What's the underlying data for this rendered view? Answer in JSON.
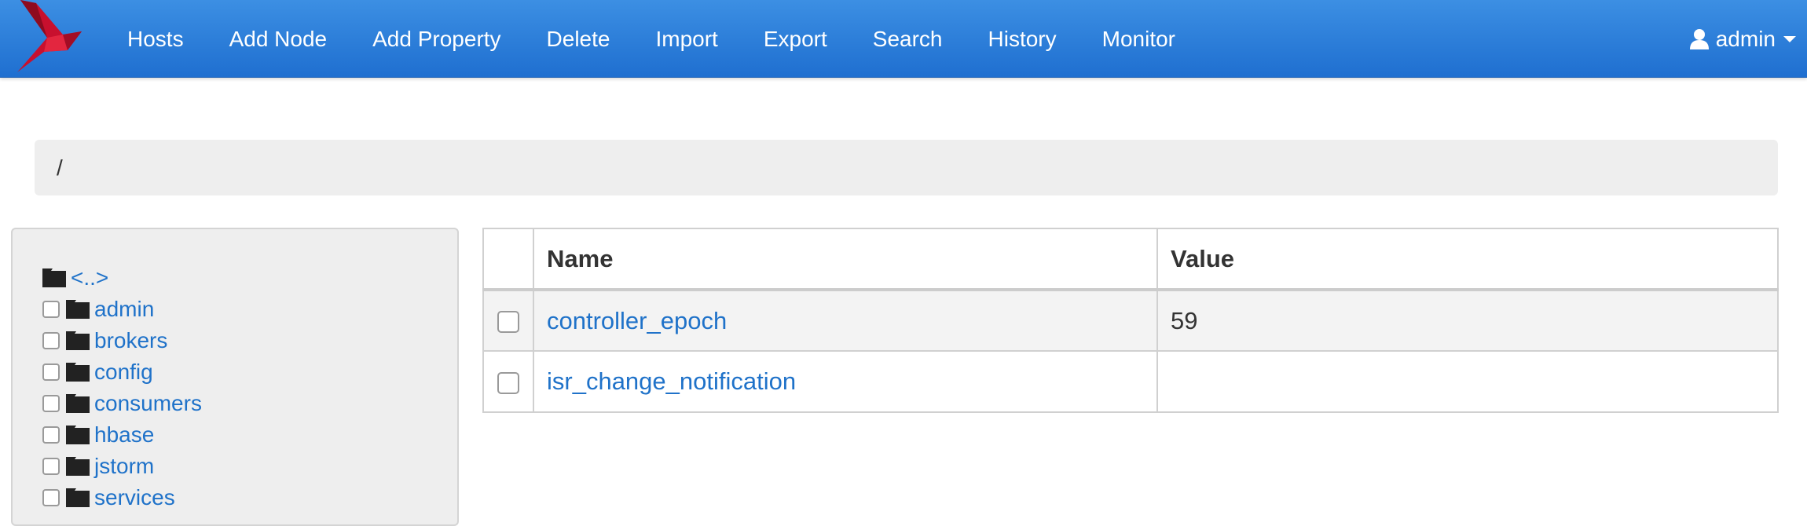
{
  "navbar": {
    "brand_icon": "bird-logo-icon",
    "items": [
      "Hosts",
      "Add Node",
      "Add Property",
      "Delete",
      "Import",
      "Export",
      "Search",
      "History",
      "Monitor"
    ],
    "user": {
      "icon": "user-icon",
      "name": "admin"
    }
  },
  "breadcrumb": {
    "path": "/"
  },
  "tree": {
    "parent_label": "<..>",
    "items": [
      "admin",
      "brokers",
      "config",
      "consumers",
      "hbase",
      "jstorm",
      "services"
    ]
  },
  "table": {
    "headers": {
      "name": "Name",
      "value": "Value"
    },
    "rows": [
      {
        "name": "controller_epoch",
        "value": "59"
      },
      {
        "name": "isr_change_notification",
        "value": ""
      }
    ]
  },
  "colors": {
    "navbar": "#2a7fdc",
    "link": "#1f72c9",
    "panel": "#eeeeee"
  }
}
